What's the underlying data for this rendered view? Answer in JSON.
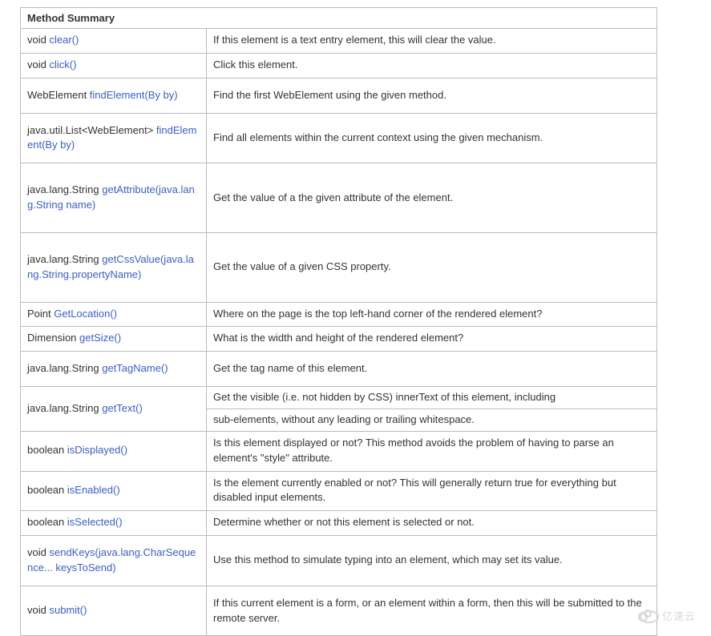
{
  "header": "Method   Summary",
  "methods": {
    "clear": {
      "ret": "void ",
      "sig": "clear()",
      "desc": "If   this element is a text entry element, this will clear the value."
    },
    "click": {
      "ret": "void ",
      "sig": "click()",
      "desc": "Click   this element."
    },
    "findElement": {
      "ret": "WebElement ",
      "sig": "findElement(By by)",
      "desc": "Find   the first WebElement  using the given method."
    },
    "findElements": {
      "ret": " java.util.List<WebElement> ",
      "sig": "findElement(By   by)",
      "desc": "Find   all elements within the current context using the given mechanism."
    },
    "getAttribute": {
      "ret": " java.lang.String ",
      "sig": "getAttribute(java.lang.String   name)",
      "desc": "Get   the value of a the given attribute of the element."
    },
    "getCssValue": {
      "ret": " java.lang.String ",
      "sig": "getCssValue(java.lang.String.propertyName)",
      "desc": "Get   the value of a given CSS property."
    },
    "getLocation": {
      "ret": "Point ",
      "sig": "GetLocation()",
      "desc": "Where   on the page is the top left-hand corner of the rendered element?"
    },
    "getSize": {
      "ret": " Dimension ",
      "sig": "getSize()",
      "desc": "What   is the width and height of the rendered element?"
    },
    "getTagName": {
      "ret": " java.lang.String ",
      "sig": "getTagName()",
      "desc": " Get   the tag name of this element."
    },
    "getText": {
      "ret": " java.lang.String ",
      "sig": "getText()",
      "desc1": " Get   the visible (i.e. not hidden by CSS) innerText of this element, including",
      "desc2": "sub-elements, without any leading or trailing whitespace."
    },
    "isDisplayed": {
      "ret": " boolean ",
      "sig": "isDisplayed()",
      "desc": "Is   this element displayed or not? This method avoids the problem of having to   parse an element's \"style\" attribute."
    },
    "isEnabled": {
      "ret": " boolean ",
      "sig": "isEnabled()",
      "desc": "Is the element currently enabled or not? This will generally return true for everything but disabled input elements."
    },
    "isSelected": {
      "ret": " boolean ",
      "sig": "isSelected()",
      "desc": "Determine   whether or not this element is selected or not."
    },
    "sendKeys": {
      "ret": " void ",
      "sig": "sendKeys(java.lang.CharSequence...   keysToSend)",
      "desc": "Use   this method to simulate typing into an element, which may set its value."
    },
    "submit": {
      "ret": " void ",
      "sig": "submit()",
      "desc": "If   this current element is a form, or an element within a form, then this will   be submitted to the remote server."
    }
  },
  "watermark": "亿速云"
}
